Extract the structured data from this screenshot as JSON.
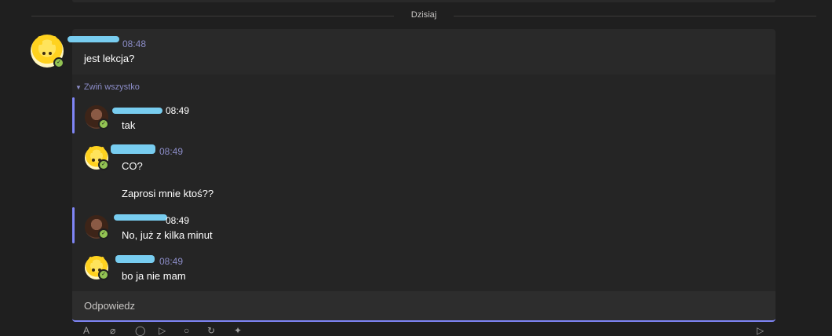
{
  "divider": {
    "label": "Dzisiaj"
  },
  "main_message": {
    "time": "08:48",
    "text": "jest lekcja?"
  },
  "thread": {
    "collapse_label": "Zwiń wszystko",
    "replies": [
      {
        "time": "08:49",
        "lines": [
          "tak"
        ]
      },
      {
        "time": "08:49",
        "lines": [
          "CO?",
          "Zaprosi mnie ktoś??"
        ]
      },
      {
        "time": "08:49",
        "lines": [
          "No, już z kilka minut"
        ]
      },
      {
        "time": "08:49",
        "lines": [
          "bo ja nie mam"
        ]
      }
    ]
  },
  "reply_box": {
    "label": "Odpowiedz"
  },
  "toolbar": {
    "icons": [
      "format-icon",
      "attach-icon",
      "emoji-icon",
      "gif-icon",
      "sticker-icon",
      "loop-icon",
      "apps-icon",
      "send-icon"
    ]
  },
  "colors": {
    "accent": "#7f85f5",
    "time": "#8b8cc7",
    "presence": "#92c353",
    "name_redaction": "#78cdf0"
  }
}
